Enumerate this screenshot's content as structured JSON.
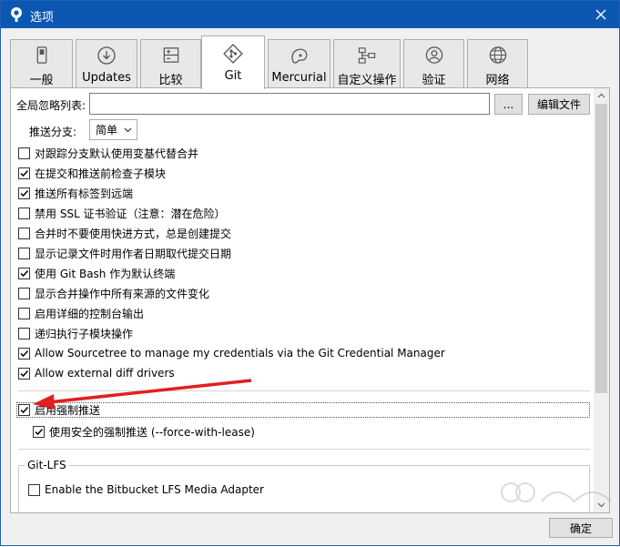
{
  "window": {
    "title": "选项"
  },
  "tabs": [
    {
      "label": "一般",
      "icon": "switch-icon"
    },
    {
      "label": "Updates",
      "icon": "download-icon"
    },
    {
      "label": "比较",
      "icon": "compare-icon"
    },
    {
      "label": "Git",
      "icon": "git-icon",
      "active": true
    },
    {
      "label": "Mercurial",
      "icon": "mercurial-icon"
    },
    {
      "label": "自定义操作",
      "icon": "custom-actions-icon"
    },
    {
      "label": "验证",
      "icon": "user-icon"
    },
    {
      "label": "网络",
      "icon": "globe-icon"
    }
  ],
  "git": {
    "ignore_label": "全局忽略列表:",
    "ignore_value": "",
    "browse_label": "...",
    "edit_file_label": "编辑文件",
    "push_branch_label": "推送分支:",
    "push_branch_value": "简单",
    "options": [
      {
        "label": "对跟踪分支默认使用变基代替合并",
        "checked": false
      },
      {
        "label": "在提交和推送前检查子模块",
        "checked": true
      },
      {
        "label": "推送所有标签到远端",
        "checked": true
      },
      {
        "label": "禁用 SSL 证书验证（注意：潜在危险）",
        "checked": false
      },
      {
        "label": "合并时不要使用快进方式，总是创建提交",
        "checked": false
      },
      {
        "label": "显示记录文件时用作者日期取代提交日期",
        "checked": false
      },
      {
        "label": "使用 Git Bash 作为默认终端",
        "checked": true
      },
      {
        "label": "显示合并操作中所有来源的文件变化",
        "checked": false
      },
      {
        "label": "启用详细的控制台输出",
        "checked": false
      },
      {
        "label": "递归执行子模块操作",
        "checked": false
      },
      {
        "label": "Allow Sourcetree to manage my credentials via the Git Credential Manager",
        "checked": true
      },
      {
        "label": "Allow external diff drivers",
        "checked": true
      }
    ],
    "force_push": {
      "label": "启用强制推送",
      "checked": true
    },
    "force_with_lease": {
      "label": "使用安全的强制推送 (--force-with-lease)",
      "checked": true
    },
    "lfs_group": "Git-LFS",
    "lfs_adapter": {
      "label": "Enable the Bitbucket LFS Media Adapter",
      "checked": false
    }
  },
  "footer": {
    "ok_label": "确定"
  },
  "colors": {
    "titlebar": "#0b57b2",
    "arrow": "#e02020"
  }
}
